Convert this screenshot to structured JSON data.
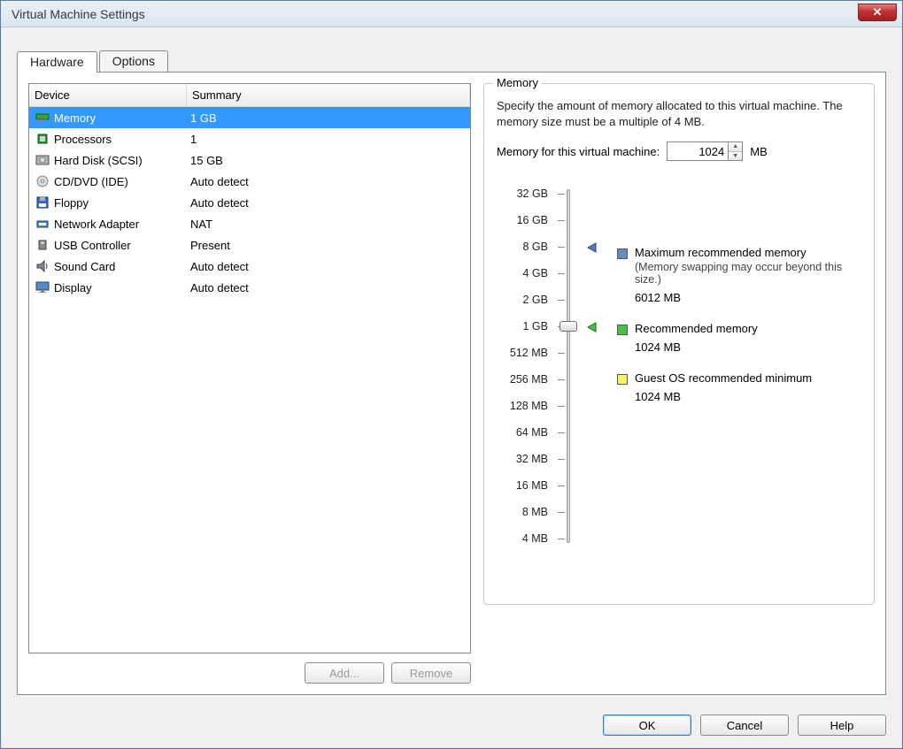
{
  "window": {
    "title": "Virtual Machine Settings"
  },
  "tabs": {
    "hardware": "Hardware",
    "options": "Options"
  },
  "table": {
    "col_device": "Device",
    "col_summary": "Summary",
    "rows": [
      {
        "name": "Memory",
        "summary": "1 GB",
        "icon": "memory"
      },
      {
        "name": "Processors",
        "summary": "1",
        "icon": "cpu"
      },
      {
        "name": "Hard Disk (SCSI)",
        "summary": "15 GB",
        "icon": "hdd"
      },
      {
        "name": "CD/DVD (IDE)",
        "summary": "Auto detect",
        "icon": "cd"
      },
      {
        "name": "Floppy",
        "summary": "Auto detect",
        "icon": "floppy"
      },
      {
        "name": "Network Adapter",
        "summary": "NAT",
        "icon": "net"
      },
      {
        "name": "USB Controller",
        "summary": "Present",
        "icon": "usb"
      },
      {
        "name": "Sound Card",
        "summary": "Auto detect",
        "icon": "sound"
      },
      {
        "name": "Display",
        "summary": "Auto detect",
        "icon": "display"
      }
    ]
  },
  "buttons": {
    "add": "Add...",
    "remove": "Remove",
    "ok": "OK",
    "cancel": "Cancel",
    "help": "Help"
  },
  "memory": {
    "group_title": "Memory",
    "desc": "Specify the amount of memory allocated to this virtual machine. The memory size must be a multiple of 4 MB.",
    "input_label": "Memory for this virtual machine:",
    "value": "1024",
    "unit": "MB",
    "ticks": [
      "32 GB",
      "16 GB",
      "8 GB",
      "4 GB",
      "2 GB",
      "1 GB",
      "512 MB",
      "256 MB",
      "128 MB",
      "64 MB",
      "32 MB",
      "16 MB",
      "8 MB",
      "4 MB"
    ],
    "legend": {
      "max": {
        "title": "Maximum recommended memory",
        "sub": "(Memory swapping may occur beyond this size.)",
        "value": "6012 MB"
      },
      "rec": {
        "title": "Recommended memory",
        "value": "1024 MB"
      },
      "min": {
        "title": "Guest OS recommended minimum",
        "value": "1024 MB"
      }
    }
  }
}
